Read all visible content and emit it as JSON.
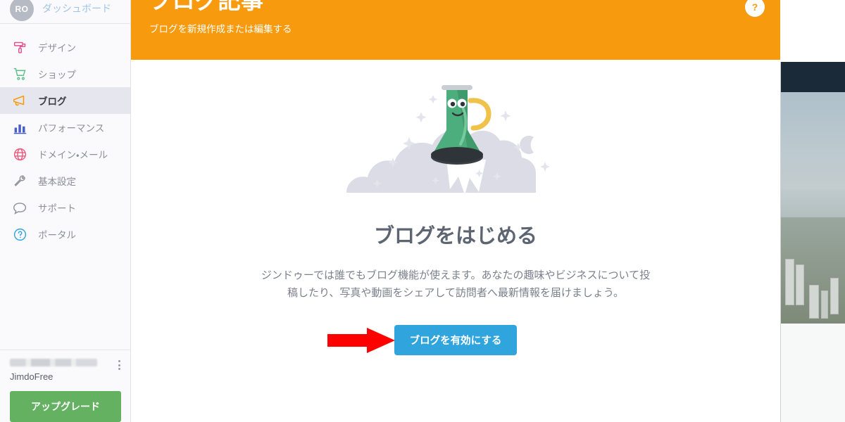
{
  "sidebar": {
    "avatar_initials": "RO",
    "dashboard_label": "ダッシュボード",
    "items": [
      {
        "label": "デザイン",
        "icon": "paint-roller-icon",
        "color": "#e0508f"
      },
      {
        "label": "ショップ",
        "icon": "shopping-cart-icon",
        "color": "#5cc08a"
      },
      {
        "label": "ブログ",
        "icon": "megaphone-icon",
        "color": "#f79a0d"
      },
      {
        "label": "パフォーマンス",
        "icon": "bar-chart-icon",
        "color": "#4a5fc1"
      },
      {
        "label": "ドメイン・メール",
        "icon": "globe-icon",
        "color": "#e8597c"
      },
      {
        "label": "基本設定",
        "icon": "wrench-icon",
        "color": "#8d8f99"
      },
      {
        "label": "サポート",
        "icon": "chat-bubble-icon",
        "color": "#8d8f99"
      },
      {
        "label": "ポータル",
        "icon": "question-circle-icon",
        "color": "#29a3e0"
      }
    ],
    "active_item": "ブログ",
    "site_name": "",
    "plan_name": "JimdoFree",
    "upgrade_label": "アップグレード"
  },
  "header": {
    "title": "ブログ記事",
    "subtitle": "ブログを新規作成または編集する",
    "help_icon_label": "?",
    "background_color": "#f79a0d"
  },
  "content": {
    "illustration_name": "flask-rocket-illustration",
    "empty_title": "ブログをはじめる",
    "empty_description": "ジンドゥーでは誰でもブログ機能が使えます。あなたの趣味やビジネスについて投稿したり、写真や動画をシェアして訪問者へ最新情報を届けましょう。",
    "cta_label": "ブログを有効にする",
    "cta_color": "#30a5dd",
    "arrow_color": "#ff0000"
  },
  "preview": {
    "panel_name": "website-preview",
    "header_color": "#1a2a39",
    "photo_description": "city-skyline-photo"
  }
}
